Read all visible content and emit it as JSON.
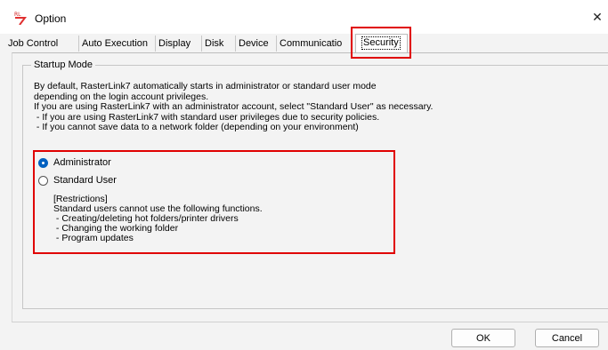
{
  "window": {
    "title": "Option"
  },
  "tabs": [
    {
      "label": "Job Control"
    },
    {
      "label": "Auto Execution"
    },
    {
      "label": "Display"
    },
    {
      "label": "Disk"
    },
    {
      "label": "Device"
    },
    {
      "label": "Communicatio"
    },
    {
      "label": "Security"
    }
  ],
  "startup_mode": {
    "legend": "Startup Mode",
    "description": [
      "By default, RasterLink7 automatically starts in administrator or standard user mode",
      "depending on the login account privileges.",
      "If you are using RasterLink7 with an administrator account, select \"Standard User\" as necessary.",
      " - If you are using RasterLink7 with standard user privileges due to security policies.",
      " - If you cannot save data to a network folder (depending on your environment)"
    ],
    "options": [
      {
        "label": "Administrator",
        "selected": true
      },
      {
        "label": "Standard User",
        "selected": false
      }
    ],
    "restrictions": [
      "[Restrictions]",
      "Standard users cannot use the following functions.",
      " - Creating/deleting hot folders/printer drivers",
      " - Changing the working folder",
      " - Program updates"
    ]
  },
  "buttons": {
    "ok": "OK",
    "cancel": "Cancel"
  },
  "colors": {
    "highlight": "#e00000",
    "radio_selected": "#0060c0"
  },
  "icons": {
    "app": "rasterlink-app-icon",
    "close": "close-icon"
  }
}
